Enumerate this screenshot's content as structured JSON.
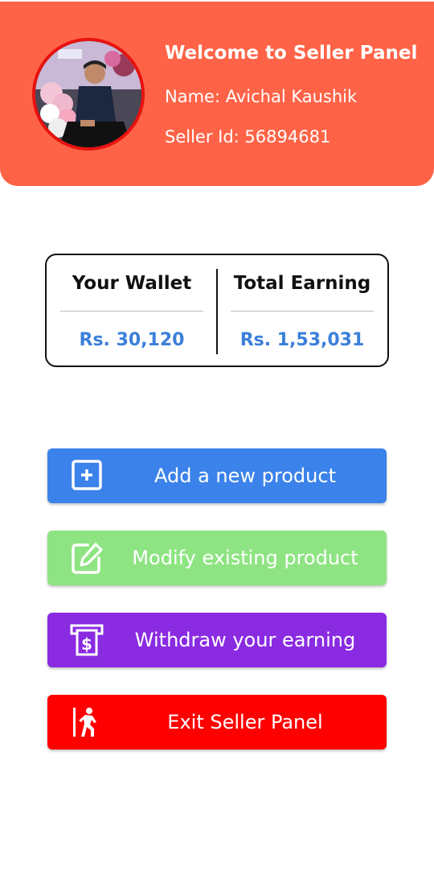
{
  "header": {
    "welcome": "Welcome to Seller Panel",
    "name_line": "Name: Avichal Kaushik",
    "seller_id_line": "Seller Id: 56894681",
    "background_color": "#ff6347"
  },
  "wallet": {
    "your_wallet_label": "Your Wallet",
    "your_wallet_value": "Rs. 30,120",
    "total_earning_label": "Total Earning",
    "total_earning_value": "Rs. 1,53,031",
    "value_color": "#3b7fd9"
  },
  "actions": [
    {
      "label": "Add a new product",
      "icon": "add-box-icon",
      "color": "#3b82ea"
    },
    {
      "label": "Modify existing product",
      "icon": "edit-icon",
      "color": "#8ee482"
    },
    {
      "label": "Withdraw your earning",
      "icon": "atm-withdraw-icon",
      "color": "#8a2be2"
    },
    {
      "label": "Exit Seller Panel",
      "icon": "exit-person-icon",
      "color": "#ff0000"
    }
  ]
}
